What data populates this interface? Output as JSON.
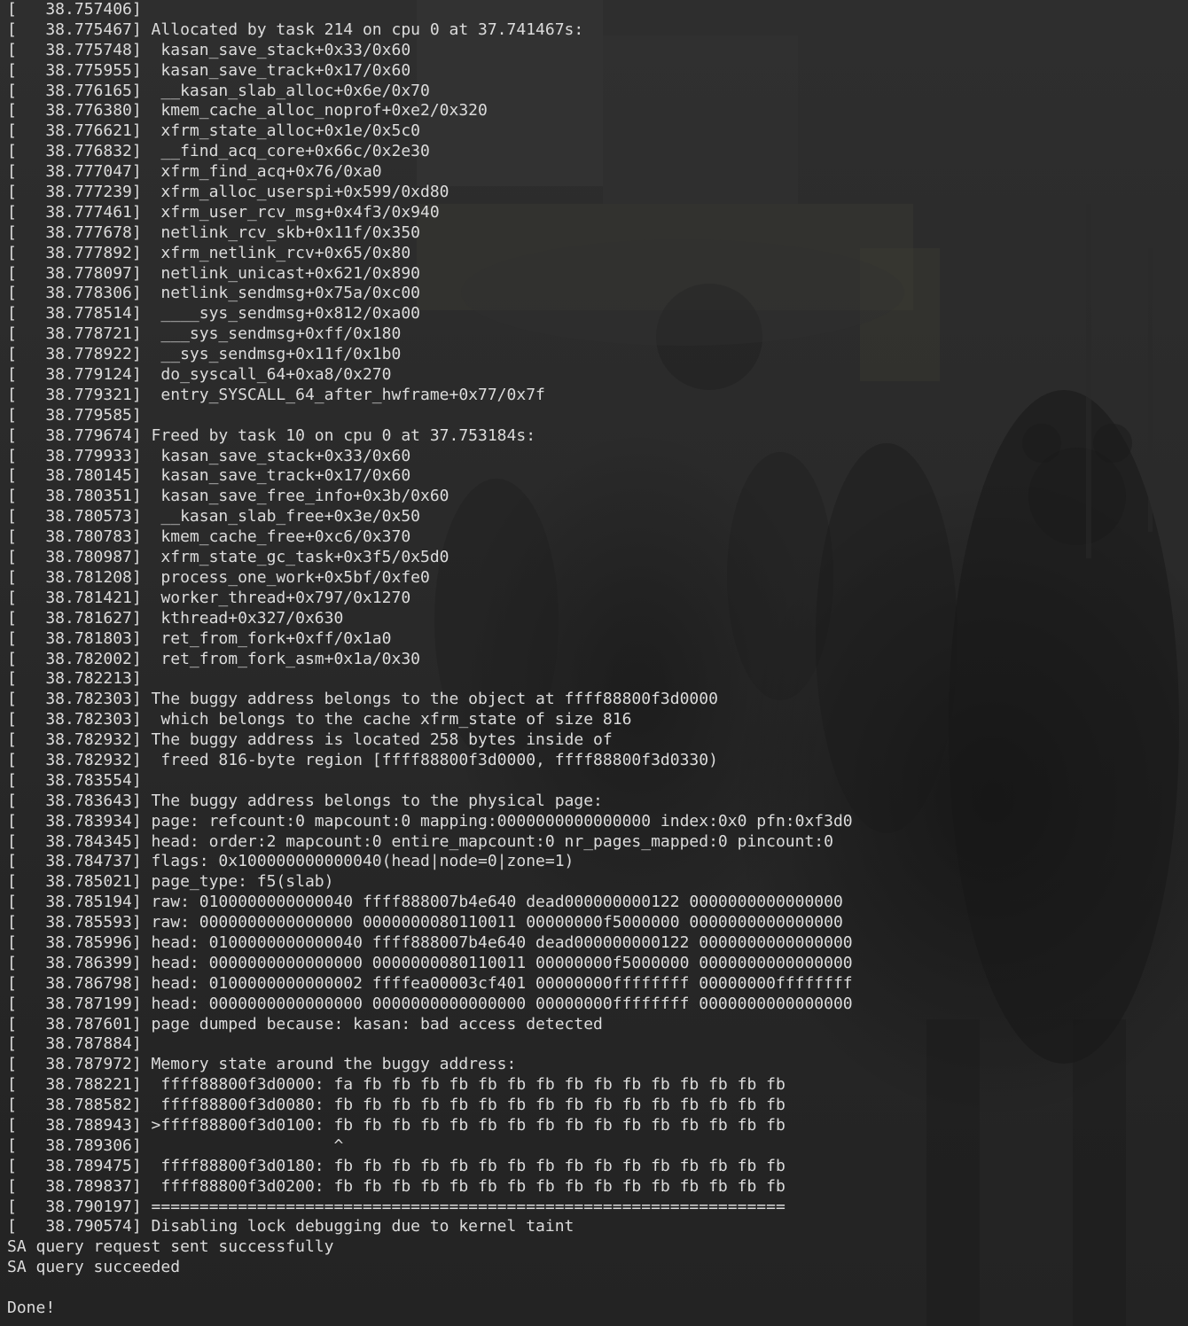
{
  "terminal": {
    "lines": [
      "[   38.757406]",
      "[   38.775467] Allocated by task 214 on cpu 0 at 37.741467s:",
      "[   38.775748]  kasan_save_stack+0x33/0x60",
      "[   38.775955]  kasan_save_track+0x17/0x60",
      "[   38.776165]  __kasan_slab_alloc+0x6e/0x70",
      "[   38.776380]  kmem_cache_alloc_noprof+0xe2/0x320",
      "[   38.776621]  xfrm_state_alloc+0x1e/0x5c0",
      "[   38.776832]  __find_acq_core+0x66c/0x2e30",
      "[   38.777047]  xfrm_find_acq+0x76/0xa0",
      "[   38.777239]  xfrm_alloc_userspi+0x599/0xd80",
      "[   38.777461]  xfrm_user_rcv_msg+0x4f3/0x940",
      "[   38.777678]  netlink_rcv_skb+0x11f/0x350",
      "[   38.777892]  xfrm_netlink_rcv+0x65/0x80",
      "[   38.778097]  netlink_unicast+0x621/0x890",
      "[   38.778306]  netlink_sendmsg+0x75a/0xc00",
      "[   38.778514]  ____sys_sendmsg+0x812/0xa00",
      "[   38.778721]  ___sys_sendmsg+0xff/0x180",
      "[   38.778922]  __sys_sendmsg+0x11f/0x1b0",
      "[   38.779124]  do_syscall_64+0xa8/0x270",
      "[   38.779321]  entry_SYSCALL_64_after_hwframe+0x77/0x7f",
      "[   38.779585]",
      "[   38.779674] Freed by task 10 on cpu 0 at 37.753184s:",
      "[   38.779933]  kasan_save_stack+0x33/0x60",
      "[   38.780145]  kasan_save_track+0x17/0x60",
      "[   38.780351]  kasan_save_free_info+0x3b/0x60",
      "[   38.780573]  __kasan_slab_free+0x3e/0x50",
      "[   38.780783]  kmem_cache_free+0xc6/0x370",
      "[   38.780987]  xfrm_state_gc_task+0x3f5/0x5d0",
      "[   38.781208]  process_one_work+0x5bf/0xfe0",
      "[   38.781421]  worker_thread+0x797/0x1270",
      "[   38.781627]  kthread+0x327/0x630",
      "[   38.781803]  ret_from_fork+0xff/0x1a0",
      "[   38.782002]  ret_from_fork_asm+0x1a/0x30",
      "[   38.782213]",
      "[   38.782303] The buggy address belongs to the object at ffff88800f3d0000",
      "[   38.782303]  which belongs to the cache xfrm_state of size 816",
      "[   38.782932] The buggy address is located 258 bytes inside of",
      "[   38.782932]  freed 816-byte region [ffff88800f3d0000, ffff88800f3d0330)",
      "[   38.783554]",
      "[   38.783643] The buggy address belongs to the physical page:",
      "[   38.783934] page: refcount:0 mapcount:0 mapping:0000000000000000 index:0x0 pfn:0xf3d0",
      "[   38.784345] head: order:2 mapcount:0 entire_mapcount:0 nr_pages_mapped:0 pincount:0",
      "[   38.784737] flags: 0x100000000000040(head|node=0|zone=1)",
      "[   38.785021] page_type: f5(slab)",
      "[   38.785194] raw: 0100000000000040 ffff888007b4e640 dead000000000122 0000000000000000",
      "[   38.785593] raw: 0000000000000000 0000000080110011 00000000f5000000 0000000000000000",
      "[   38.785996] head: 0100000000000040 ffff888007b4e640 dead000000000122 0000000000000000",
      "[   38.786399] head: 0000000000000000 0000000080110011 00000000f5000000 0000000000000000",
      "[   38.786798] head: 0100000000000002 ffffea00003cf401 00000000ffffffff 00000000ffffffff",
      "[   38.787199] head: 0000000000000000 0000000000000000 00000000ffffffff 0000000000000000",
      "[   38.787601] page dumped because: kasan: bad access detected",
      "[   38.787884]",
      "[   38.787972] Memory state around the buggy address:",
      "[   38.788221]  ffff88800f3d0000: fa fb fb fb fb fb fb fb fb fb fb fb fb fb fb fb",
      "[   38.788582]  ffff88800f3d0080: fb fb fb fb fb fb fb fb fb fb fb fb fb fb fb fb",
      "[   38.788943] >ffff88800f3d0100: fb fb fb fb fb fb fb fb fb fb fb fb fb fb fb fb",
      "[   38.789306]                    ^",
      "[   38.789475]  ffff88800f3d0180: fb fb fb fb fb fb fb fb fb fb fb fb fb fb fb fb",
      "[   38.789837]  ffff88800f3d0200: fb fb fb fb fb fb fb fb fb fb fb fb fb fb fb fb",
      "[   38.790197] ==================================================================",
      "[   38.790574] Disabling lock debugging due to kernel taint",
      "SA query request sent successfully",
      "SA query succeeded",
      "",
      "Done!"
    ]
  },
  "colors": {
    "background": "#262626",
    "text": "#dcdcdc"
  }
}
